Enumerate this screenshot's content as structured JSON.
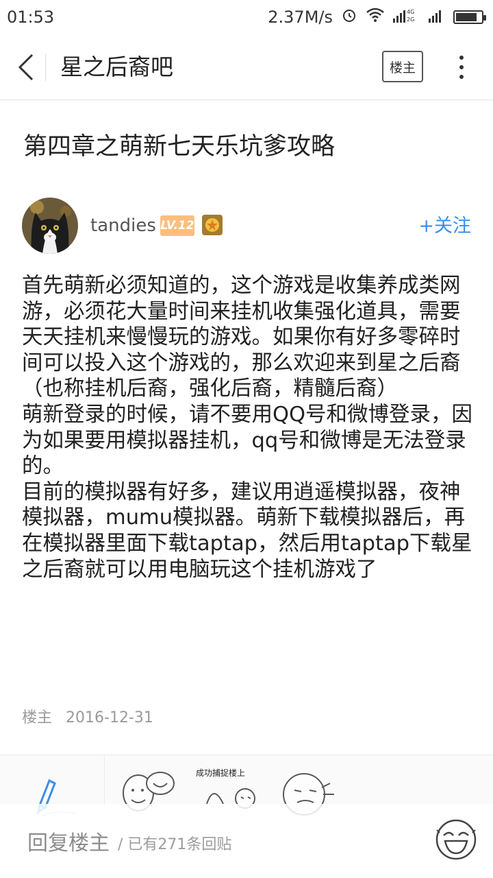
{
  "status_bar": {
    "time": "01:53",
    "speed": "2.37M/s",
    "network_1": "4G",
    "network_2": "2G"
  },
  "nav": {
    "title": "星之后裔吧",
    "owner_button": "楼主"
  },
  "post": {
    "title": "第四章之萌新七天乐坑爹攻略",
    "author": {
      "name": "tandies",
      "level": "LV.12"
    },
    "follow_label": "+关注",
    "paragraphs": [
      "首先萌新必须知道的，这个游戏是收集养成类网游，必须花大量时间来挂机收集强化道具，需要天天挂机来慢慢玩的游戏。如果你有好多零碎时间可以投入这个游戏的，那么欢迎来到星之后裔（也称挂机后裔，强化后裔，精髓后裔）",
      "萌新登录的时候，请不要用QQ号和微博登录，因为如果要用模拟器挂机，qq号和微博是无法登录的。",
      "目前的模拟器有好多，建议用逍遥模拟器，夜神模拟器，mumu模拟器。萌新下载模拟器后，再在模拟器里面下载taptap，然后用taptap下载星之后裔就可以用电脑玩这个挂机游戏了"
    ],
    "meta_role": "楼主",
    "meta_date": "2016-12-31"
  },
  "sticker_panel": {
    "caption": "成功捕捉楼上"
  },
  "reply_bar": {
    "label": "回复楼主",
    "count_text": "/ 已有271条回贴"
  },
  "colors": {
    "accent": "#3c8ee8",
    "level_badge": "#fbbf7d",
    "muted_text": "#9a9a9a"
  }
}
